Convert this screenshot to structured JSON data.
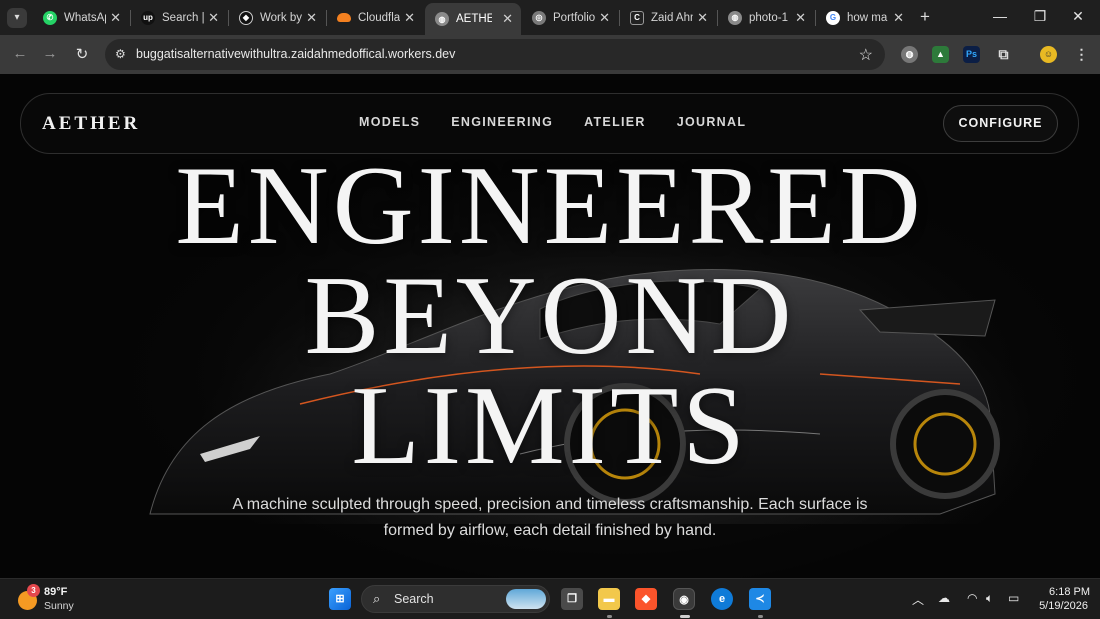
{
  "browser": {
    "tabs": [
      {
        "label": "WhatsApp",
        "icon": "whatsapp-icon",
        "color": "#25d366"
      },
      {
        "label": "Search | Upwork",
        "icon": "upwork-icon",
        "color": "#111111"
      },
      {
        "label": "Work by",
        "icon": "work-icon",
        "color": "#111111"
      },
      {
        "label": "Cloudflare",
        "icon": "cloudflare-icon",
        "color": "#f38020"
      },
      {
        "label": "AETHER",
        "icon": "globe-icon",
        "color": "#8a8a8a",
        "active": true
      },
      {
        "label": "Portfolio",
        "icon": "portfolio-icon",
        "color": "#7a7a7a"
      },
      {
        "label": "Zaid Ahmed",
        "icon": "github-icon",
        "color": "#222222"
      },
      {
        "label": "photo-1",
        "icon": "globe-icon",
        "color": "#8a8a8a"
      },
      {
        "label": "how ma",
        "icon": "google-icon",
        "color": "#ffffff"
      }
    ],
    "url": "buggatisalternativewithultra.zaidahmedoffical.workers.dev"
  },
  "site": {
    "brand": "AETHER",
    "nav": [
      "MODELS",
      "ENGINEERING",
      "ATELIER",
      "JOURNAL"
    ],
    "cta": "CONFIGURE",
    "headline": [
      "ENGINEERED",
      "BEYOND",
      "LIMITS"
    ],
    "subtitle": [
      "A machine sculpted through speed, precision and timeless craftsmanship. Each surface is",
      "formed by airflow, each detail finished by hand."
    ]
  },
  "taskbar": {
    "weather_temp": "89°F",
    "weather_desc": "Sunny",
    "weather_badge": "3",
    "search_label": "Search",
    "time": "6:18 PM",
    "date": "5/19/2026"
  },
  "colors": {
    "accent_orange": "#d4561f",
    "page_bg": "#050505",
    "text": "#f4f4f4"
  }
}
